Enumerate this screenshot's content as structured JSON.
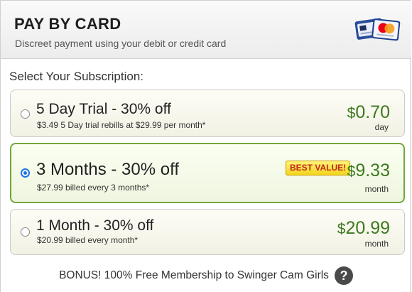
{
  "header": {
    "title": "PAY BY CARD",
    "subtitle": "Discreet payment using your debit or credit card",
    "logo_icons": [
      "card-icon",
      "mastercard-icon"
    ]
  },
  "subscription": {
    "section_label": "Select Your Subscription:",
    "selected_index": 1,
    "options": [
      {
        "name": "5 Day Trial - 30% off",
        "description": "$3.49 5 Day trial rebills at $29.99 per month*",
        "currency": "$",
        "price": "0.70",
        "period": "day",
        "selected": false
      },
      {
        "name": "3 Months - 30% off",
        "description": "$27.99 billed every 3 months*",
        "currency": "$",
        "price": "9.33",
        "period": "month",
        "badge": "BEST VALUE!",
        "selected": true
      },
      {
        "name": "1 Month - 30% off",
        "description": "$20.99 billed every month*",
        "currency": "$",
        "price": "20.99",
        "period": "month",
        "selected": false
      }
    ]
  },
  "bonus": {
    "text": "BONUS! 100% Free Membership to Swinger Cam Girls",
    "help_icon": "?"
  },
  "colors": {
    "price_green": "#3d7a1e",
    "selected_border": "#73a73a",
    "radio_blue": "#1a73e8",
    "badge_yellow": "#f3d51b",
    "badge_text": "#c0281c"
  }
}
